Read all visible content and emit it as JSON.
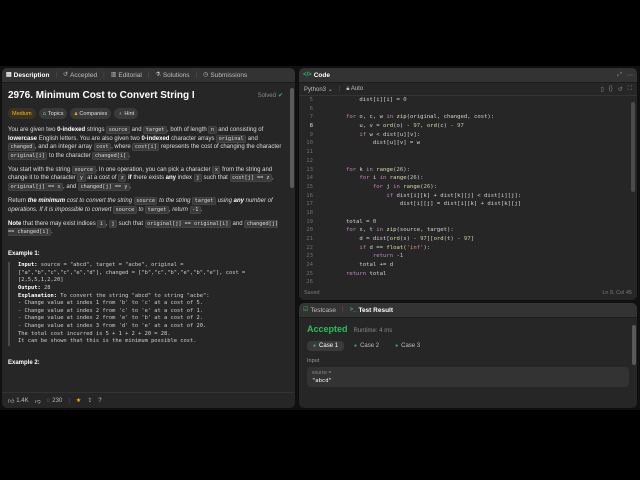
{
  "left": {
    "tabs": [
      {
        "label": "Description",
        "icon": "description-icon"
      },
      {
        "label": "Accepted",
        "icon": "history-icon"
      },
      {
        "label": "Editorial",
        "icon": "book-icon"
      },
      {
        "label": "Solutions",
        "icon": "flask-icon"
      },
      {
        "label": "Submissions",
        "icon": "clock-icon"
      }
    ],
    "title": "2976. Minimum Cost to Convert String I",
    "status": "Solved",
    "pills": {
      "difficulty": "Medium",
      "topics": "Topics",
      "companies": "Companies",
      "hint": "Hint"
    },
    "examples": {
      "ex1_title": "Example 1:",
      "ex2_title": "Example 2:"
    },
    "footer": {
      "likes": "1.4K",
      "comments": "230"
    }
  },
  "code": {
    "title": "Code",
    "language": "Python3",
    "mode": "Auto",
    "status": "Saved",
    "position": "Ln 8, Col 45",
    "lines": [
      {
        "n": "5",
        "text": "            dist[i][i] = 0"
      },
      {
        "n": "6",
        "text": ""
      },
      {
        "n": "7",
        "text": "        for o, c, w in zip(original, changed, cost):"
      },
      {
        "n": "8",
        "text": "            u, v = ord(o) - 97, ord(c) - 97"
      },
      {
        "n": "9",
        "text": "            if w < dist[u][v]:"
      },
      {
        "n": "10",
        "text": "                dist[u][v] = w"
      },
      {
        "n": "11",
        "text": ""
      },
      {
        "n": "12",
        "text": ""
      },
      {
        "n": "13",
        "text": "        for k in range(26):"
      },
      {
        "n": "14",
        "text": "            for i in range(26):"
      },
      {
        "n": "15",
        "text": "                for j in range(26):"
      },
      {
        "n": "16",
        "text": "                    if dist[i][k] + dist[k][j] < dist[i][j]:"
      },
      {
        "n": "17",
        "text": "                        dist[i][j] = dist[i][k] + dist[k][j]"
      },
      {
        "n": "18",
        "text": ""
      },
      {
        "n": "19",
        "text": "        total = 0"
      },
      {
        "n": "20",
        "text": "        for s, t in zip(source, target):"
      },
      {
        "n": "21",
        "text": "            d = dist[ord(s) - 97][ord(t) - 97]"
      },
      {
        "n": "22",
        "text": "            if d == float('inf'):"
      },
      {
        "n": "23",
        "text": "                return -1"
      },
      {
        "n": "24",
        "text": "            total += d"
      },
      {
        "n": "25",
        "text": "        return total"
      },
      {
        "n": "26",
        "text": ""
      }
    ]
  },
  "test": {
    "tab1": "Testcase",
    "tab2": "Test Result",
    "result": "Accepted",
    "runtime": "Runtime: 4 ms",
    "cases": [
      "Case 1",
      "Case 2",
      "Case 3"
    ],
    "input_label": "Input",
    "var_name": "source =",
    "var_value": "\"abcd\""
  },
  "colors": {
    "accepted": "#2cbb5d",
    "medium": "#ffb800"
  }
}
